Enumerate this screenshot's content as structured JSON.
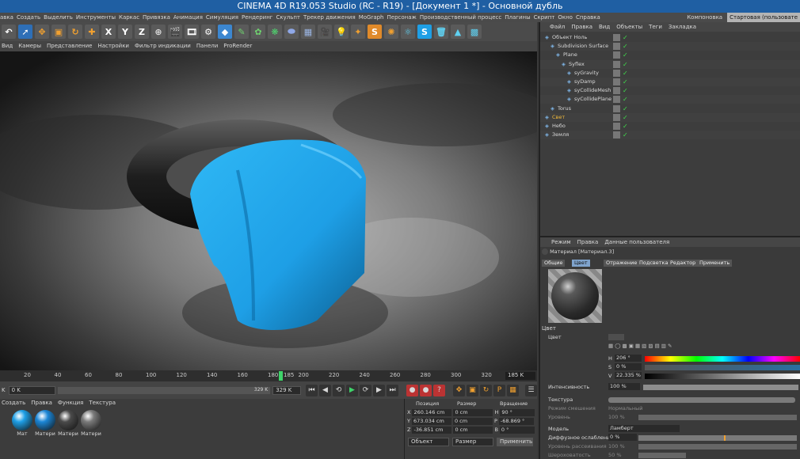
{
  "window": {
    "title": "CINEMA 4D R19.053 Studio (RC - R19) - [Документ 1 *] - Основной дубль"
  },
  "menubar": [
    "авка",
    "Создать",
    "Выделить",
    "Инструменты",
    "Каркас",
    "Привязка",
    "Анимация",
    "Симуляция",
    "Рендеринг",
    "Скульпт",
    "Трекер движения",
    "MoGraph",
    "Персонаж",
    "Производственный процесс",
    "Плагины",
    "Скрипт",
    "Окно",
    "Справка"
  ],
  "layouts": {
    "label": "Компоновка",
    "current": "Стартовая (пользовате"
  },
  "toolbar": {
    "axes": [
      "X",
      "Y",
      "Z"
    ]
  },
  "viewport_menu": [
    "Вид",
    "Камеры",
    "Представление",
    "Настройки",
    "Фильтр индикации",
    "Панели",
    "ProRender"
  ],
  "timeline": {
    "ticks": [
      "20",
      "40",
      "60",
      "80",
      "100",
      "120",
      "140",
      "160",
      "180",
      "200",
      "220",
      "240",
      "260",
      "280",
      "300",
      "320"
    ],
    "current_frame": "185",
    "end_frame": "185 K"
  },
  "transport": {
    "start_label": "K",
    "start_field": "0 K",
    "range_end": "329 K",
    "end_field": "329 K"
  },
  "materials": {
    "menu": [
      "Создать",
      "Правка",
      "Функция",
      "Текстура"
    ],
    "items": [
      {
        "label": "Мат",
        "color": "#1e9fe6"
      },
      {
        "label": "Матери",
        "color": "#1b86d6"
      },
      {
        "label": "Матери",
        "color": "#4a4a4a"
      },
      {
        "label": "Матери",
        "color": "#7a7a7a"
      }
    ]
  },
  "coords": {
    "headers": [
      "Позиция",
      "Размер",
      "Вращение"
    ],
    "rows": [
      {
        "axis": "X",
        "pos": "260.146 cm",
        "size": "0 cm",
        "rot_axis": "H",
        "rot": "90 °"
      },
      {
        "axis": "Y",
        "pos": "673.034 cm",
        "size": "0 cm",
        "rot_axis": "P",
        "rot": "-68.869 °"
      },
      {
        "axis": "Z",
        "pos": "-36.851 cm",
        "size": "0 cm",
        "rot_axis": "B",
        "rot": "0 °"
      }
    ],
    "mode": "Объект",
    "size_mode": "Размер",
    "apply": "Применить"
  },
  "object_manager": {
    "menu": [
      "Файл",
      "Правка",
      "Вид",
      "Объекты",
      "Теги",
      "Закладка"
    ],
    "objects": [
      {
        "name": "Объект Ноль",
        "indent": 0,
        "color": "#d8d8d8"
      },
      {
        "name": "Subdivision Surface",
        "indent": 1,
        "color": "#d8d8d8"
      },
      {
        "name": "Plane",
        "indent": 2,
        "color": "#d8d8d8"
      },
      {
        "name": "Syflex",
        "indent": 3,
        "color": "#d8d8d8"
      },
      {
        "name": "syGravity",
        "indent": 4,
        "color": "#d8d8d8"
      },
      {
        "name": "syDamp",
        "indent": 4,
        "color": "#d8d8d8"
      },
      {
        "name": "syCollideMesh",
        "indent": 4,
        "color": "#d8d8d8"
      },
      {
        "name": "syCollidePlane",
        "indent": 4,
        "color": "#d8d8d8"
      },
      {
        "name": "Torus",
        "indent": 1,
        "color": "#d8d8d8"
      },
      {
        "name": "Свет",
        "indent": 0,
        "color": "#f0b93a"
      },
      {
        "name": "Небо",
        "indent": 0,
        "color": "#d8d8d8"
      },
      {
        "name": "Земля",
        "indent": 0,
        "color": "#d8d8d8"
      }
    ]
  },
  "attributes": {
    "menu": [
      "Режим",
      "Правка",
      "Данные пользователя"
    ],
    "title": "Материал [Материал.3]",
    "tabs": [
      "Общие",
      "Цвет",
      "Отражение",
      "Подсветка",
      "Редактор",
      "Применить"
    ],
    "section": "Цвет",
    "color_label": "Цвет",
    "hsv": [
      {
        "k": "H",
        "v": "206 °"
      },
      {
        "k": "S",
        "v": "0 %"
      },
      {
        "k": "V",
        "v": "22.335 %"
      }
    ],
    "intensity": {
      "label": "Интенсивность",
      "value": "100 %"
    },
    "texture": {
      "label": "Текстура"
    },
    "blend": {
      "label": "Режим смешения",
      "value": "Нормальный"
    },
    "level": {
      "label": "Уровень",
      "value": "100 %"
    },
    "model": {
      "label": "Модель",
      "value": "Ламберт"
    },
    "diffuse": {
      "label": "Диффузное ослабление",
      "value": "0 %"
    },
    "scatter": {
      "label": "Уровень рассеивания",
      "value": "100 %"
    },
    "roughness": {
      "label": "Шероховатость",
      "value": "50 %"
    }
  }
}
